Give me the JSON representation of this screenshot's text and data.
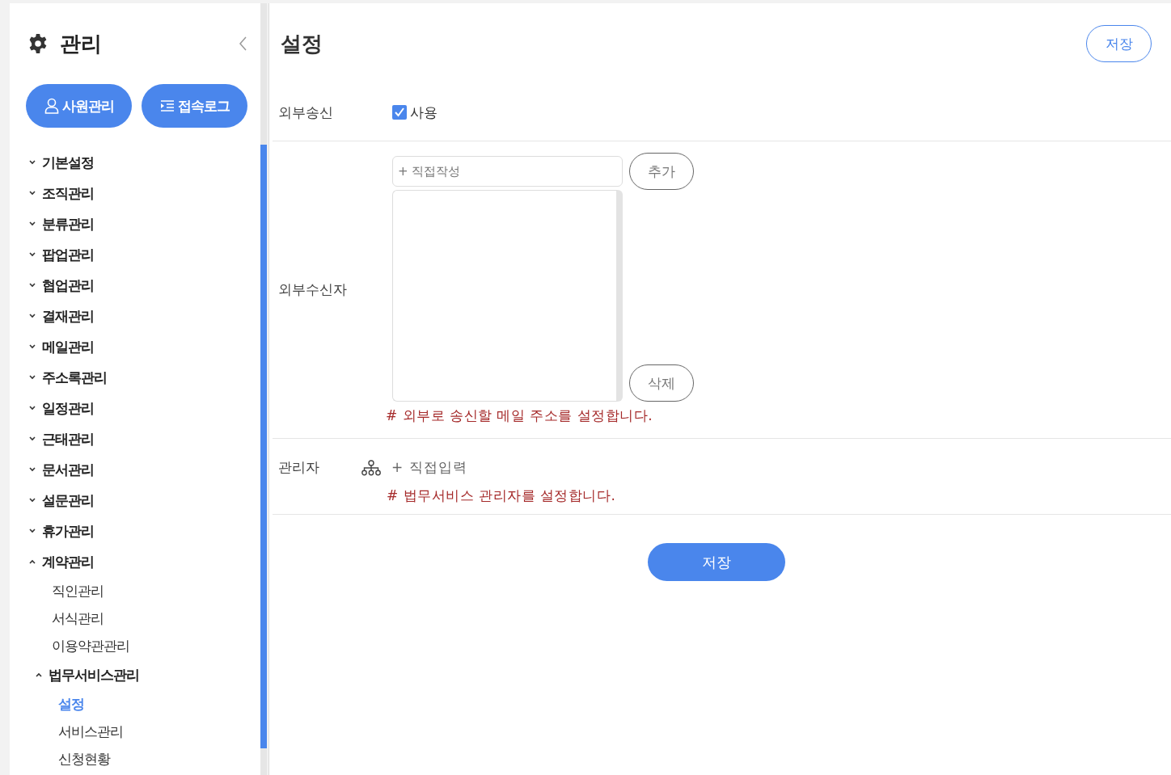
{
  "sidebar": {
    "title": "관리",
    "buttons": [
      {
        "kind": "person",
        "label": "사원관리"
      },
      {
        "kind": "log",
        "label": "접속로그"
      }
    ],
    "tree": [
      {
        "label": "기본설정",
        "expanded": false
      },
      {
        "label": "조직관리",
        "expanded": false
      },
      {
        "label": "분류관리",
        "expanded": false
      },
      {
        "label": "팝업관리",
        "expanded": false
      },
      {
        "label": "협업관리",
        "expanded": false
      },
      {
        "label": "결재관리",
        "expanded": false
      },
      {
        "label": "메일관리",
        "expanded": false
      },
      {
        "label": "주소록관리",
        "expanded": false
      },
      {
        "label": "일정관리",
        "expanded": false
      },
      {
        "label": "근태관리",
        "expanded": false
      },
      {
        "label": "문서관리",
        "expanded": false
      },
      {
        "label": "설문관리",
        "expanded": false
      },
      {
        "label": "휴가관리",
        "expanded": false
      },
      {
        "label": "계약관리",
        "expanded": true,
        "children": [
          {
            "label": "직인관리",
            "selected": false
          },
          {
            "label": "서식관리",
            "selected": false
          },
          {
            "label": "이용약관관리",
            "selected": false
          },
          {
            "label": "법무서비스관리",
            "expanded": true,
            "children": [
              {
                "label": "설정",
                "selected": true
              },
              {
                "label": "서비스관리",
                "selected": false
              },
              {
                "label": "신청현황",
                "selected": false
              }
            ]
          }
        ]
      }
    ]
  },
  "main": {
    "title": "설정",
    "top_save": "저장",
    "external_send": {
      "label": "외부송신",
      "checkbox_label": "사용",
      "checked": true
    },
    "external_recipients": {
      "label": "외부수신자",
      "placeholder": "+ 직접작성",
      "add": "추가",
      "delete": "삭제",
      "note": "# 외부로 송신할 메일 주소를 설정합니다."
    },
    "admin": {
      "label": "관리자",
      "link": "+ 직접입력",
      "note": "# 법무서비스 관리자를 설정합니다."
    },
    "save": "저장"
  }
}
